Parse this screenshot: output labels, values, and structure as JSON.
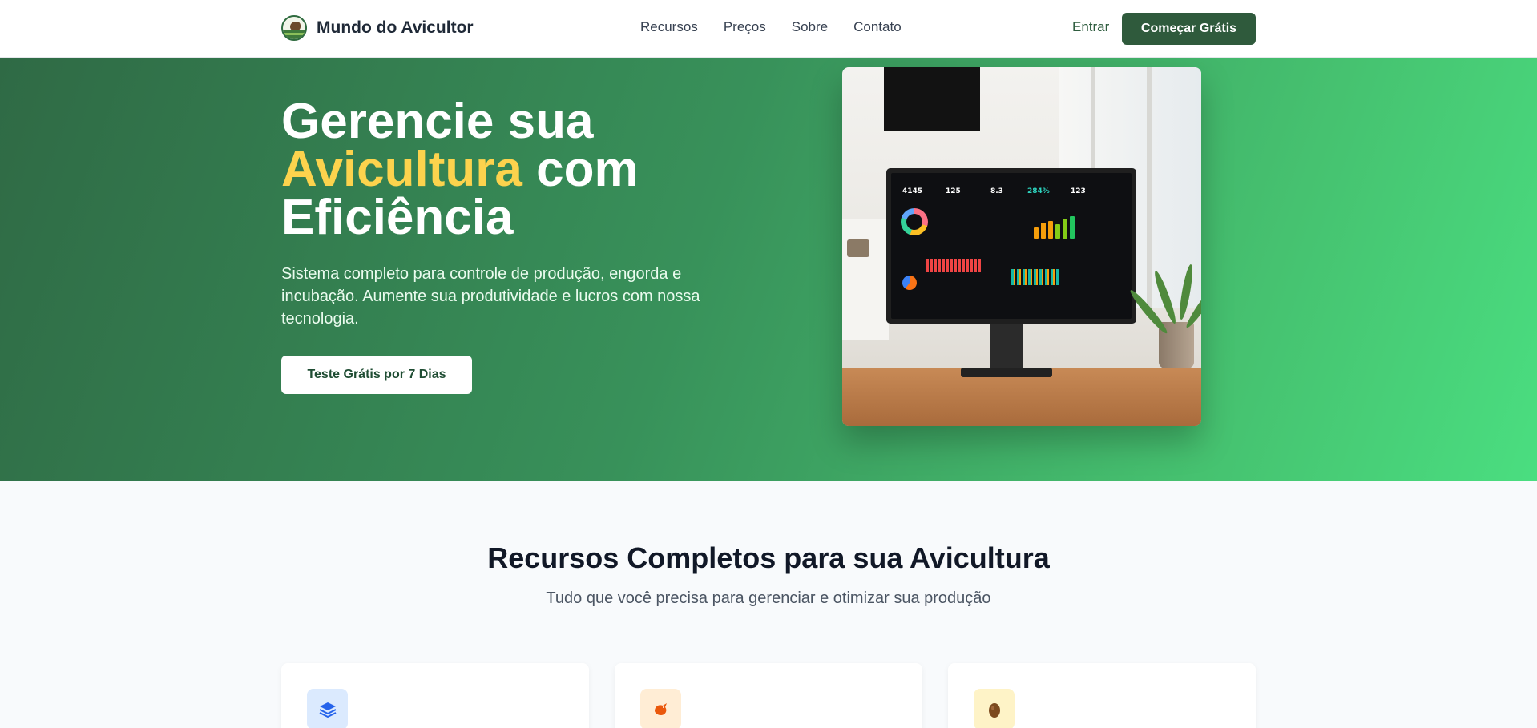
{
  "header": {
    "brand": "Mundo do Avicultor",
    "nav": [
      "Recursos",
      "Preços",
      "Sobre",
      "Contato"
    ],
    "login": "Entrar",
    "cta": "Começar Grátis"
  },
  "hero": {
    "title_line1": "Gerencie sua",
    "title_accent": "Avicultura",
    "title_rest": "com",
    "title_line3": "Eficiência",
    "subtitle": "Sistema completo para controle de produção, engorda e incubação. Aumente sua produtividade e lucros com nossa tecnologia.",
    "cta": "Teste Grátis por 7 Dias"
  },
  "dashboard": {
    "kpis": [
      "4145",
      "125",
      "8.3",
      "284%",
      "123"
    ]
  },
  "features": {
    "title": "Recursos Completos para sua Avicultura",
    "subtitle": "Tudo que você precisa para gerenciar e otimizar sua produção",
    "cards": [
      {
        "icon": "layers-icon",
        "color": "#2563eb",
        "bg": "#dbeafe"
      },
      {
        "icon": "bird-icon",
        "color": "#ea580c",
        "bg": "#ffedd5"
      },
      {
        "icon": "egg-icon",
        "color": "#7c4a1e",
        "bg": "#fef3c7"
      }
    ]
  },
  "colors": {
    "primary": "#2f5a3c",
    "accent": "#fcd34d",
    "hero_start": "#2f6a45",
    "hero_end": "#4ade80"
  }
}
